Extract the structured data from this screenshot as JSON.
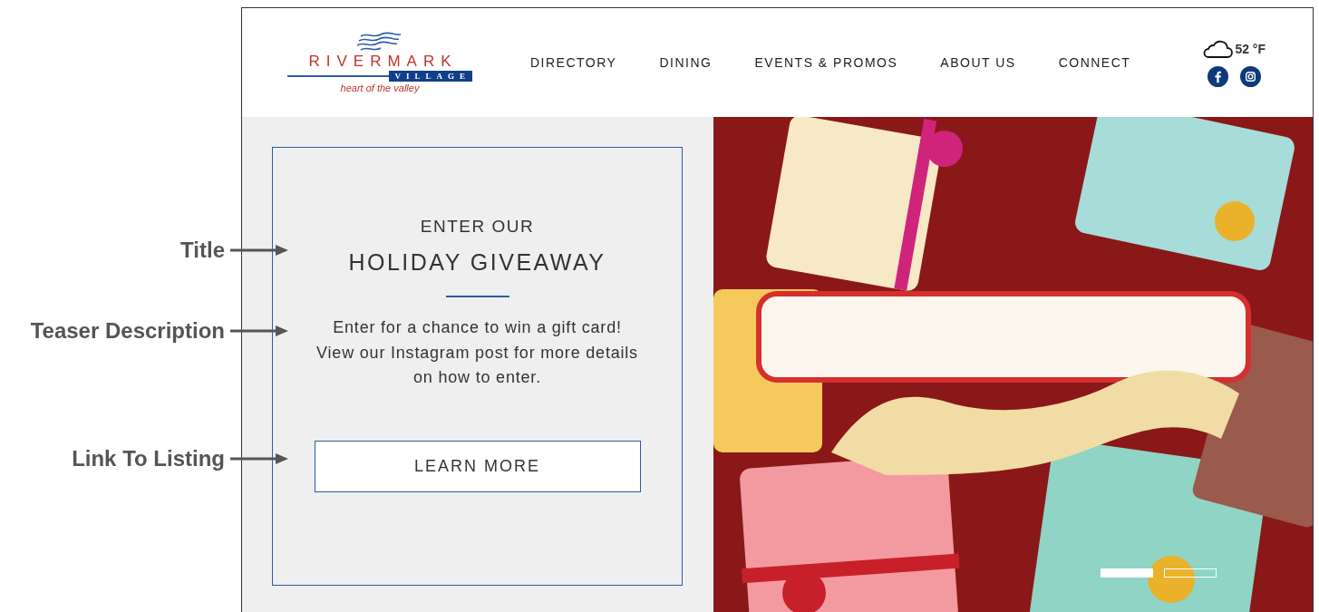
{
  "annotations": [
    {
      "label": "Title"
    },
    {
      "label": "Teaser Description"
    },
    {
      "label": "Link To Listing"
    }
  ],
  "header": {
    "logo": {
      "name": "RIVERMARK",
      "sub": "VILLAGE",
      "tagline": "heart of the valley"
    },
    "nav": [
      {
        "label": "DIRECTORY"
      },
      {
        "label": "DINING"
      },
      {
        "label": "EVENTS & PROMOS"
      },
      {
        "label": "ABOUT US"
      },
      {
        "label": "CONNECT"
      }
    ],
    "weather": {
      "temperature": "52 °F"
    }
  },
  "promo": {
    "eyebrow": "ENTER OUR",
    "title": "HOLIDAY GIVEAWAY",
    "description": "Enter for a chance to win a gift card! View our Instagram post for more details on how to enter.",
    "button": "LEARN MORE"
  },
  "hero": {
    "kind": "picture",
    "slides": [
      {
        "selected": true
      },
      {
        "selected": false
      }
    ]
  }
}
